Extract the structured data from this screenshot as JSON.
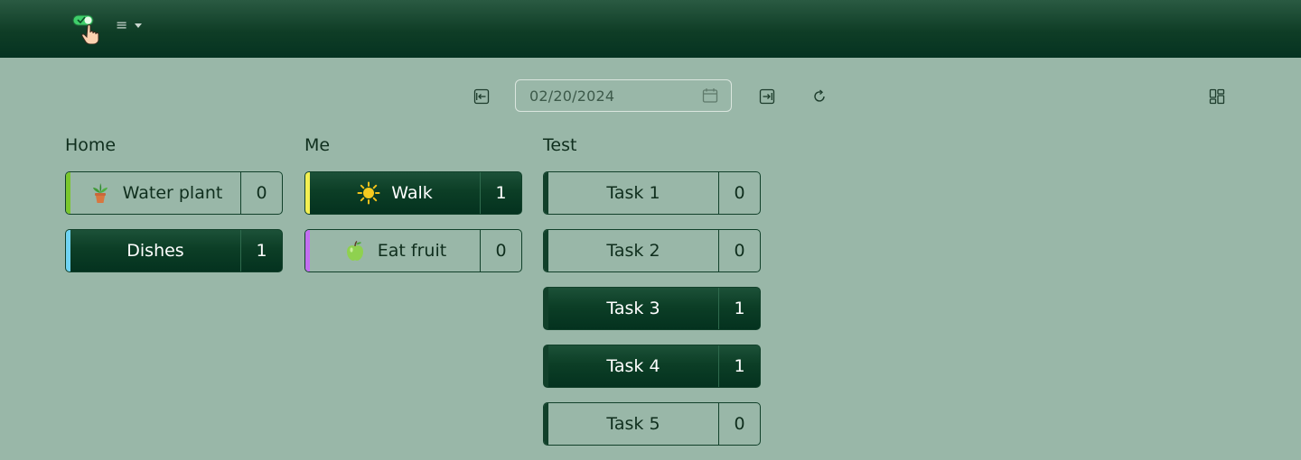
{
  "navbar": {
    "logo_icon": "toggle-hand-icon",
    "menu_icon": "hamburger-icon",
    "menu_label": "≡"
  },
  "toolbar": {
    "prev_icon": "arrow-left-bar-icon",
    "date_value": "02/20/2024",
    "calendar_icon": "calendar-icon",
    "next_icon": "arrow-right-bar-icon",
    "refresh_icon": "refresh-icon",
    "layout_icon": "layout-grid-icon"
  },
  "columns": [
    {
      "title": "Home",
      "chores": [
        {
          "name": "Water plant",
          "count": "0",
          "done": false,
          "accent": "#7ac62e",
          "icon": "potted-plant-icon"
        },
        {
          "name": "Dishes",
          "count": "1",
          "done": true,
          "accent": "#6fd3f2",
          "icon": ""
        }
      ]
    },
    {
      "title": "Me",
      "chores": [
        {
          "name": "Walk",
          "count": "1",
          "done": true,
          "accent": "#f4ef52",
          "icon": "sun-icon"
        },
        {
          "name": "Eat fruit",
          "count": "0",
          "done": false,
          "accent": "#c36ef0",
          "icon": "green-apple-icon"
        }
      ]
    },
    {
      "title": "Test",
      "chores": [
        {
          "name": "Task 1",
          "count": "0",
          "done": false,
          "accent": "#11402a",
          "icon": ""
        },
        {
          "name": "Task 2",
          "count": "0",
          "done": false,
          "accent": "#11402a",
          "icon": ""
        },
        {
          "name": "Task 3",
          "count": "1",
          "done": true,
          "accent": "#11402a",
          "icon": ""
        },
        {
          "name": "Task 4",
          "count": "1",
          "done": true,
          "accent": "#11402a",
          "icon": ""
        },
        {
          "name": "Task 5",
          "count": "0",
          "done": false,
          "accent": "#11402a",
          "icon": ""
        }
      ]
    }
  ]
}
